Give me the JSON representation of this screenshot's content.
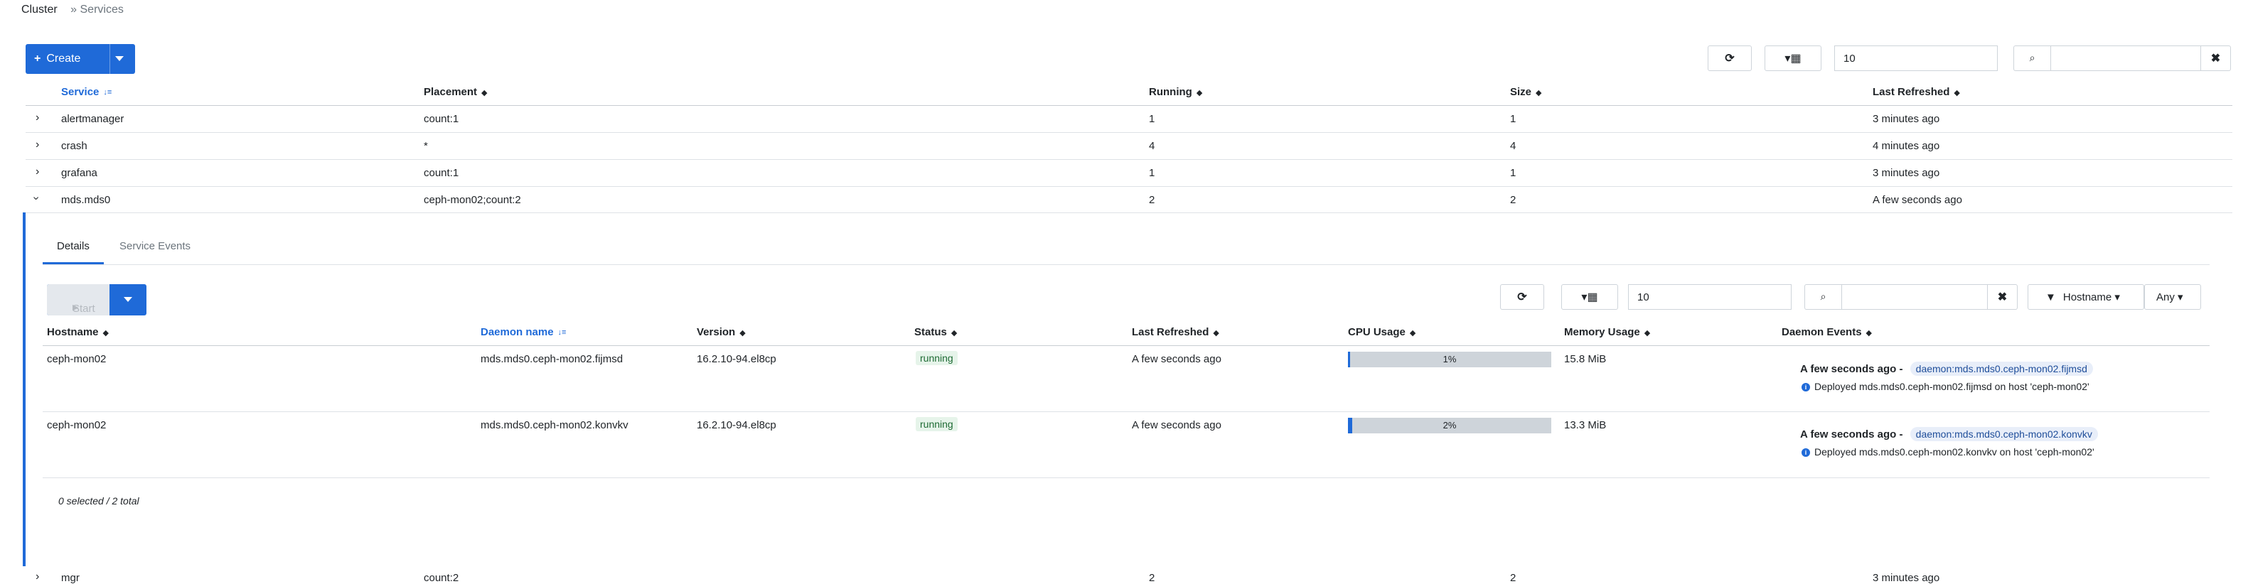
{
  "breadcrumb": {
    "root": "Cluster",
    "sep": "»",
    "current": "Services"
  },
  "toolbar": {
    "create_label": "Create",
    "page_size": "10",
    "search_value": "",
    "refresh_icon": "refresh-icon",
    "columns_icon": "columns-icon",
    "search_icon": "search-icon",
    "clear_icon": "close-icon"
  },
  "services_table": {
    "headers": [
      "Service",
      "Placement",
      "Running",
      "Size",
      "Last Refreshed"
    ],
    "rows": [
      {
        "service": "alertmanager",
        "placement": "count:1",
        "running": "1",
        "size": "1",
        "refreshed": "3 minutes ago"
      },
      {
        "service": "crash",
        "placement": "*",
        "running": "4",
        "size": "4",
        "refreshed": "4 minutes ago"
      },
      {
        "service": "grafana",
        "placement": "count:1",
        "running": "1",
        "size": "1",
        "refreshed": "3 minutes ago"
      },
      {
        "service": "mds.mds0",
        "placement": "ceph-mon02;count:2",
        "running": "2",
        "size": "2",
        "refreshed": "A few seconds ago"
      },
      {
        "service": "mgr",
        "placement": "count:2",
        "running": "2",
        "size": "2",
        "refreshed": "3 minutes ago"
      }
    ]
  },
  "details": {
    "tabs": [
      "Details",
      "Service Events"
    ],
    "start_label": "Start",
    "page_size": "10",
    "search_value": "",
    "filter_label": "Hostname",
    "filter_value": "Any",
    "headers": [
      "Hostname",
      "Daemon name",
      "Version",
      "Status",
      "Last Refreshed",
      "CPU Usage",
      "Memory Usage",
      "Daemon Events"
    ],
    "rows": [
      {
        "hostname": "ceph-mon02",
        "daemon": "mds.mds0.ceph-mon02.fijmsd",
        "version": "16.2.10-94.el8cp",
        "status": "running",
        "refreshed": "A few seconds ago",
        "cpu": "1%",
        "cpu_fraction": 0.01,
        "memory": "15.8 MiB",
        "event_time": "A few seconds ago -",
        "event_tag": "daemon:mds.mds0.ceph-mon02.fijmsd",
        "event_msg": "Deployed mds.mds0.ceph-mon02.fijmsd on host 'ceph-mon02'"
      },
      {
        "hostname": "ceph-mon02",
        "daemon": "mds.mds0.ceph-mon02.konvkv",
        "version": "16.2.10-94.el8cp",
        "status": "running",
        "refreshed": "A few seconds ago",
        "cpu": "2%",
        "cpu_fraction": 0.02,
        "memory": "13.3 MiB",
        "event_time": "A few seconds ago -",
        "event_tag": "daemon:mds.mds0.ceph-mon02.konvkv",
        "event_msg": "Deployed mds.mds0.ceph-mon02.konvkv on host 'ceph-mon02'"
      }
    ],
    "footer": "0 selected / 2 total"
  },
  "colors": {
    "accent": "#1f6ad8",
    "running": "#1e6b34"
  }
}
